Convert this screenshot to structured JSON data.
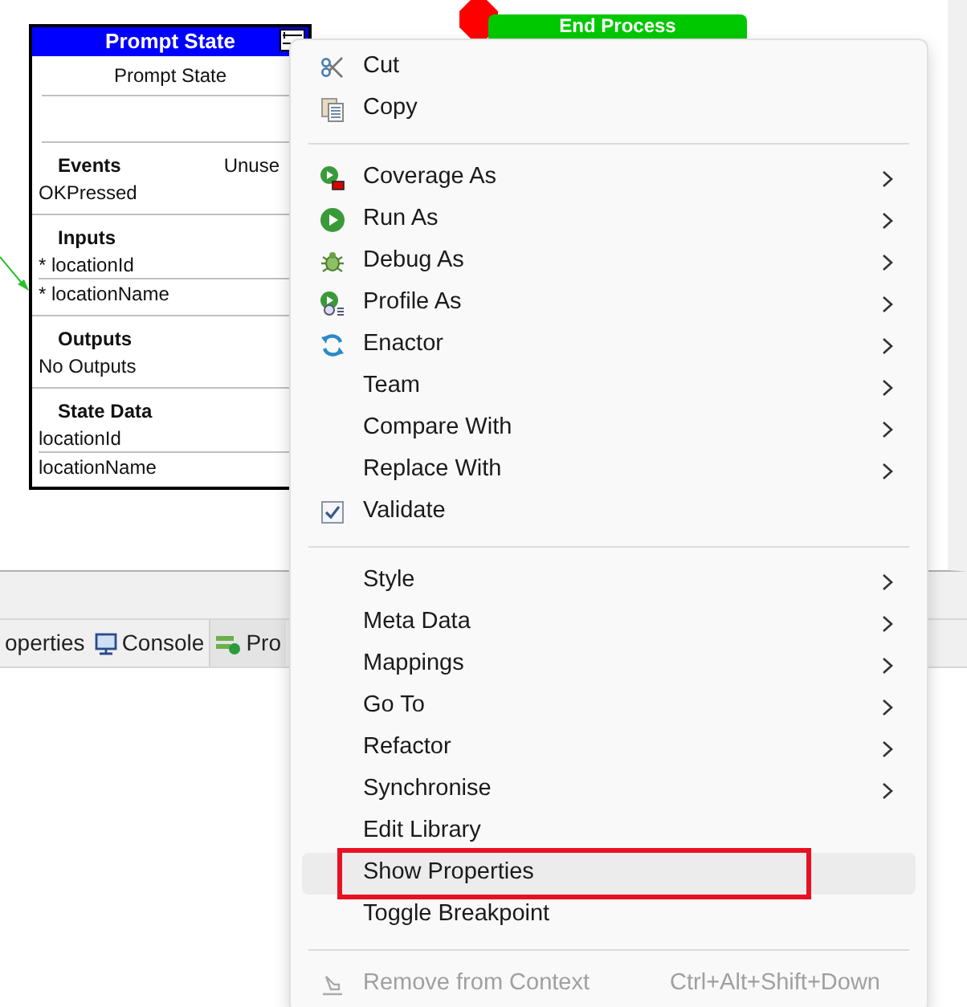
{
  "diagram": {
    "state_node": {
      "title": "Prompt State",
      "name": "Prompt State",
      "sections": [
        {
          "heading": "Events",
          "note": "Unuse",
          "rows": [
            "OKPressed"
          ]
        },
        {
          "heading": "Inputs",
          "rows": [
            "* locationId",
            "* locationName"
          ]
        },
        {
          "heading": "Outputs",
          "rows": [
            "No Outputs"
          ]
        },
        {
          "heading": "State Data",
          "rows": [
            "locationId",
            "locationName"
          ]
        }
      ]
    },
    "end_node": {
      "title": "End Process"
    }
  },
  "bottom_tabs": [
    {
      "label": "operties",
      "selected": false
    },
    {
      "label": "Console",
      "selected": false
    },
    {
      "label": "Pro",
      "selected": true
    }
  ],
  "context_menu": [
    {
      "kind": "item",
      "label": "Cut",
      "submenu": false
    },
    {
      "kind": "item",
      "label": "Copy",
      "submenu": false
    },
    {
      "kind": "separator"
    },
    {
      "kind": "item",
      "label": "Coverage As",
      "submenu": true
    },
    {
      "kind": "item",
      "label": "Run As",
      "submenu": true
    },
    {
      "kind": "item",
      "label": "Debug As",
      "submenu": true
    },
    {
      "kind": "item",
      "label": "Profile As",
      "submenu": true
    },
    {
      "kind": "item",
      "label": "Enactor",
      "submenu": true
    },
    {
      "kind": "item",
      "label": "Team",
      "submenu": true
    },
    {
      "kind": "item",
      "label": "Compare With",
      "submenu": true
    },
    {
      "kind": "item",
      "label": "Replace With",
      "submenu": true
    },
    {
      "kind": "item",
      "label": "Validate",
      "submenu": false
    },
    {
      "kind": "separator"
    },
    {
      "kind": "item",
      "label": "Style",
      "submenu": true
    },
    {
      "kind": "item",
      "label": "Meta Data",
      "submenu": true
    },
    {
      "kind": "item",
      "label": "Mappings",
      "submenu": true
    },
    {
      "kind": "item",
      "label": "Go To",
      "submenu": true
    },
    {
      "kind": "item",
      "label": "Refactor",
      "submenu": true
    },
    {
      "kind": "item",
      "label": "Synchronise",
      "submenu": true
    },
    {
      "kind": "item",
      "label": "Edit Library",
      "submenu": false
    },
    {
      "kind": "item",
      "label": "Show Properties",
      "submenu": false,
      "selected": true
    },
    {
      "kind": "item",
      "label": "Toggle Breakpoint",
      "submenu": false
    },
    {
      "kind": "separator"
    },
    {
      "kind": "item",
      "label": "Remove from Context",
      "submenu": false,
      "disabled": true,
      "shortcut": "Ctrl+Alt+Shift+Down"
    }
  ]
}
